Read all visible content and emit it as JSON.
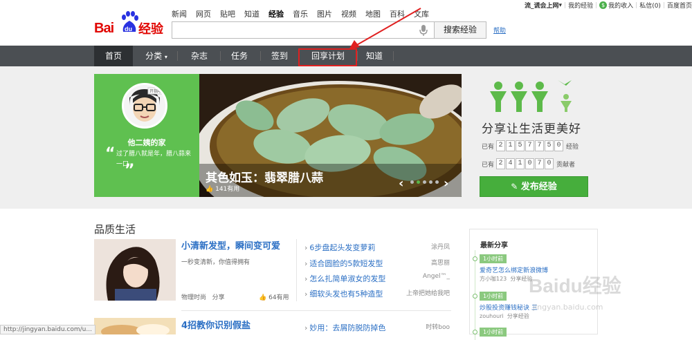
{
  "header": {
    "logo_text": "Bai",
    "logo_du": "du",
    "logo_product": "经验",
    "top_nav": [
      "新闻",
      "网页",
      "贴吧",
      "知道",
      "经验",
      "音乐",
      "图片",
      "视频",
      "地图",
      "百科",
      "文库"
    ],
    "search_placeholder": "",
    "search_button": "搜索经验",
    "help": "帮助",
    "user": {
      "name": "流_谎会上网",
      "my_exp": "我的经验",
      "my_income": "我的收入",
      "messages": "私信(0)",
      "home": "百度首页"
    }
  },
  "navbar": {
    "items": [
      {
        "label": "首页",
        "active": true
      },
      {
        "label": "分类"
      },
      {
        "label": "杂志"
      },
      {
        "label": "任务"
      },
      {
        "label": "签到"
      },
      {
        "label": "回享计划",
        "highlighted": true
      },
      {
        "label": "知道"
      }
    ]
  },
  "feature": {
    "author_badge": "开指哦",
    "author": "他二姨的家",
    "quote": "过了腊八就是年，腊八蒜来一口",
    "title": "其色如玉：翡翠腊八蒜",
    "likes": "141有用"
  },
  "stats": {
    "slogan": "分享让生活更美好",
    "exp_prefix": "已有",
    "exp_digits": [
      "2",
      "1",
      "5",
      "7",
      "7",
      "5",
      "0"
    ],
    "exp_suffix": "经验",
    "contrib_prefix": "已有",
    "contrib_digits": [
      "2",
      "4",
      "1",
      "0",
      "7",
      "0"
    ],
    "contrib_suffix": "贡献者",
    "publish_button": "发布经验"
  },
  "section": {
    "title": "品质生活",
    "article1": {
      "title": "小清新发型，瞬间变可爱",
      "desc": "一秒变清新，你值得拥有",
      "category": "物理时尚",
      "share": "分享",
      "likes": "64有用"
    },
    "list": [
      {
        "title": "6步盘起头发变萝莉",
        "author": "涂丹凤"
      },
      {
        "title": "适合圆脸的5款短发型",
        "author": "高思丽"
      },
      {
        "title": "怎么扎简单淑女的发型",
        "author": "Angel™_"
      },
      {
        "title": "细软头发也有5种造型",
        "author": "上帝把她给我吧"
      }
    ],
    "article2": {
      "title": "4招教你识别假盐"
    },
    "list2": [
      {
        "title": "妙用：去屑防脱防掉色",
        "author": "时转boo"
      }
    ]
  },
  "latest": {
    "title": "最新分享",
    "items": [
      {
        "time": "1小时前",
        "title": "爱奇艺怎么绑定新浪微博",
        "user": "方小咖123",
        "action": "分享经验"
      },
      {
        "time": "1小时前",
        "title": "炒股投资赚钱秘诀 三",
        "user": "zouhouri",
        "action": "分享经验"
      },
      {
        "time": "1小时前",
        "title": "",
        "user": "",
        "action": ""
      }
    ]
  },
  "watermark": {
    "brand": "Baidu经验",
    "url": "jingyan.baidu.com"
  },
  "status_url": "http://jingyan.baidu.com/u...",
  "colors": {
    "brand_red": "#e10602",
    "green": "#46ae3c",
    "nav_bg": "#4b4f53",
    "link": "#2b6fc4"
  }
}
